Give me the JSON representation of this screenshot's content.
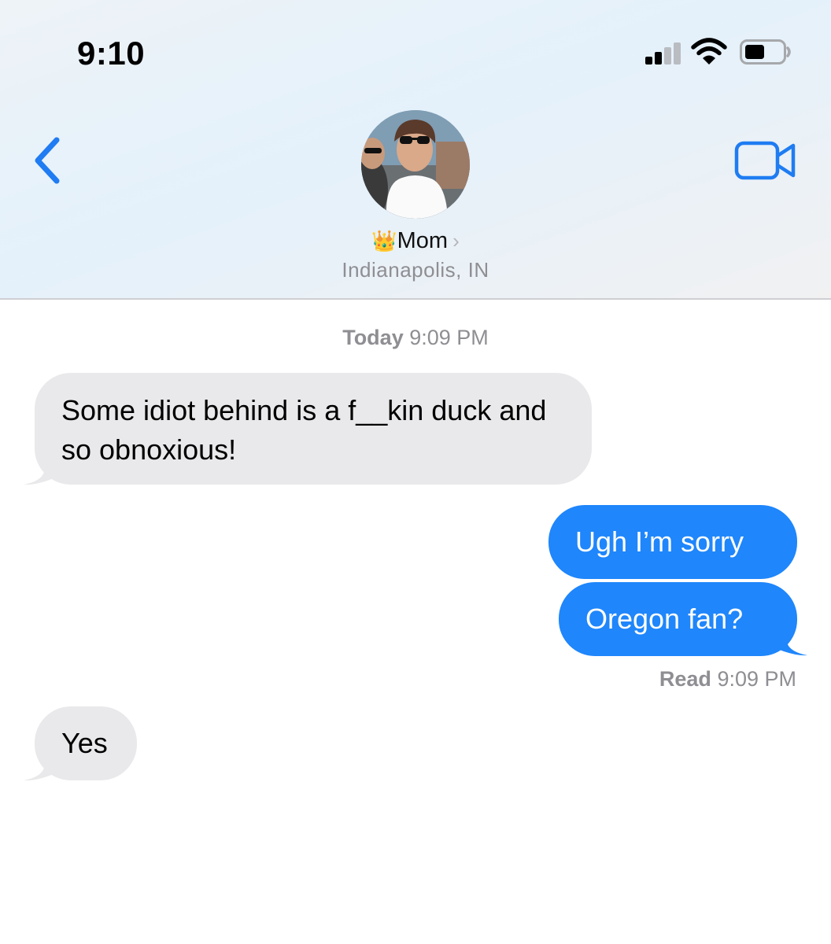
{
  "status_bar": {
    "time": "9:10"
  },
  "contact": {
    "name": "Mom",
    "crown_emoji": "👑",
    "location": "Indianapolis, IN"
  },
  "thread": {
    "day": "Today",
    "time": "9:09 PM"
  },
  "messages": [
    {
      "from": "incoming",
      "text": "Some idiot behind is a f__kin duck and so obnoxious!"
    },
    {
      "from": "outgoing",
      "text": "Ugh I’m sorry"
    },
    {
      "from": "outgoing",
      "text": "Oregon fan?"
    },
    {
      "from": "incoming",
      "text": "Yes"
    }
  ],
  "receipt": {
    "label": "Read",
    "time": "9:09 PM"
  },
  "colors": {
    "outgoing_bubble": "#1f86fb",
    "incoming_bubble": "#e9e9eb",
    "accent": "#1f7cf2"
  },
  "icons": {
    "back": "chevron-left-icon",
    "video": "video-camera-icon"
  }
}
